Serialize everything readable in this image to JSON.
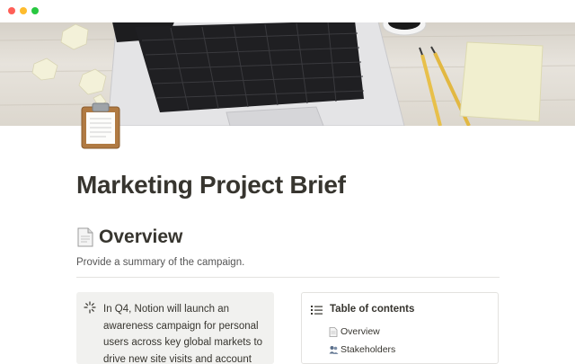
{
  "window": {
    "buttons": [
      "close",
      "minimize",
      "maximize"
    ]
  },
  "cover": {
    "description_icon": "desk-laptop-cover-image"
  },
  "page": {
    "icon": "clipboard-icon",
    "title": "Marketing Project Brief"
  },
  "overview": {
    "icon": "document-icon",
    "heading": "Overview",
    "summary": "Provide a summary of the campaign."
  },
  "callout": {
    "icon": "sparkle-icon",
    "text": "In Q4, Notion will launch an awareness campaign for personal users across key global markets to drive new site visits and account"
  },
  "toc": {
    "icon": "list-icon",
    "title": "Table of contents",
    "items": [
      {
        "icon": "document-icon",
        "label": "Overview"
      },
      {
        "icon": "people-icon",
        "label": "Stakeholders"
      }
    ]
  },
  "colors": {
    "text": "#37352f",
    "muted": "#555555",
    "callout_bg": "#f1f1ef",
    "divider": "#e3e2df"
  }
}
